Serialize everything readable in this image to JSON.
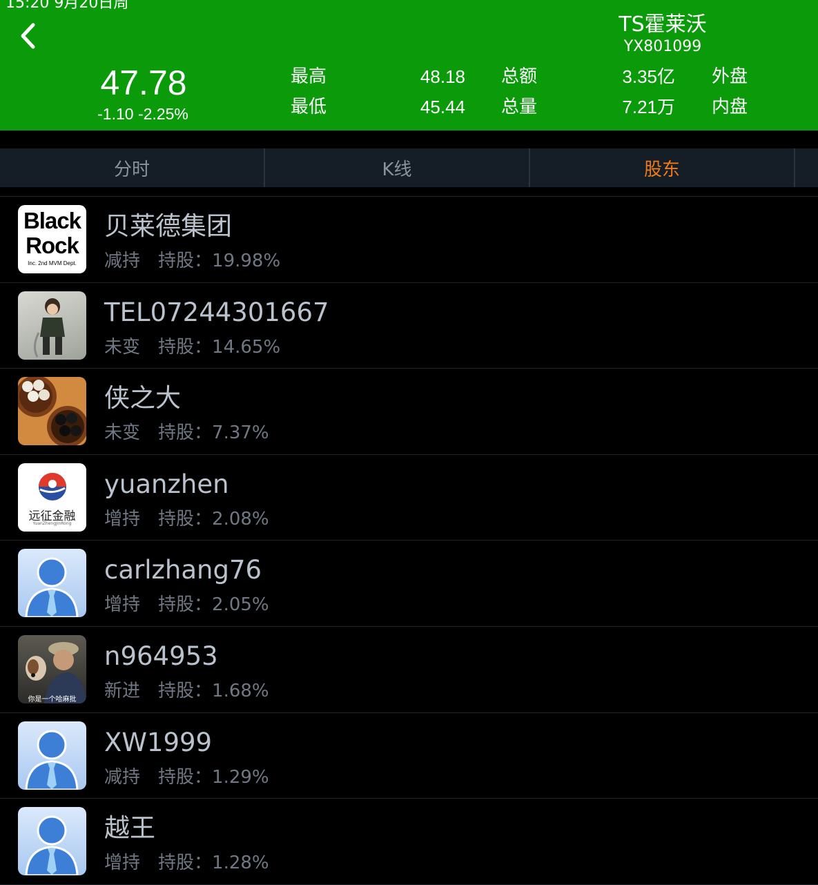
{
  "status_bar": {
    "text": "15:20  9月20日周"
  },
  "header": {
    "stock_name": "TS霍莱沃",
    "stock_code": "YX801099",
    "price": "47.78",
    "change": "-1.10  -2.25%",
    "stats": {
      "high_label": "最高",
      "high_value": "48.18",
      "low_label": "最低",
      "low_value": "45.44",
      "amount_label": "总额",
      "amount_value": "3.35亿",
      "volume_label": "总量",
      "volume_value": "7.21万",
      "outer_label": "外盘",
      "inner_label": "内盘"
    },
    "background_color": "#0a9a0a"
  },
  "tabs": [
    {
      "label": "分时",
      "active": false
    },
    {
      "label": "K线",
      "active": false
    },
    {
      "label": "股东",
      "active": true
    }
  ],
  "accent_color": "#f07b1a",
  "shareholders": [
    {
      "name": "贝莱德集团",
      "action": "减持",
      "holding_label": "持股：",
      "holding": "19.98%",
      "avatar": "blackrock-logo",
      "avatar_text": [
        "Black",
        "Rock",
        "Inc. 2nd MVM Dept."
      ]
    },
    {
      "name": "TEL07244301667",
      "action": "未变",
      "holding_label": "持股：",
      "holding": "14.65%",
      "avatar": "warrior-character"
    },
    {
      "name": "侠之大",
      "action": "未变",
      "holding_label": "持股：",
      "holding": "7.37%",
      "avatar": "go-stones"
    },
    {
      "name": "yuanzhen",
      "action": "增持",
      "holding_label": "持股：",
      "holding": "2.08%",
      "avatar": "yuanzheng-logo",
      "avatar_text": [
        "远征金融",
        "YuanZhengJinRong"
      ]
    },
    {
      "name": "carlzhang76",
      "action": "增持",
      "holding_label": "持股：",
      "holding": "2.05%",
      "avatar": "default-user"
    },
    {
      "name": "n964953",
      "action": "新进",
      "holding_label": "持股：",
      "holding": "1.68%",
      "avatar": "man-with-dog",
      "avatar_text": [
        "你是一个哈麻批"
      ]
    },
    {
      "name": "XW1999",
      "action": "减持",
      "holding_label": "持股：",
      "holding": "1.29%",
      "avatar": "default-user"
    },
    {
      "name": "越王",
      "action": "增持",
      "holding_label": "持股：",
      "holding": "1.28%",
      "avatar": "default-user"
    }
  ]
}
